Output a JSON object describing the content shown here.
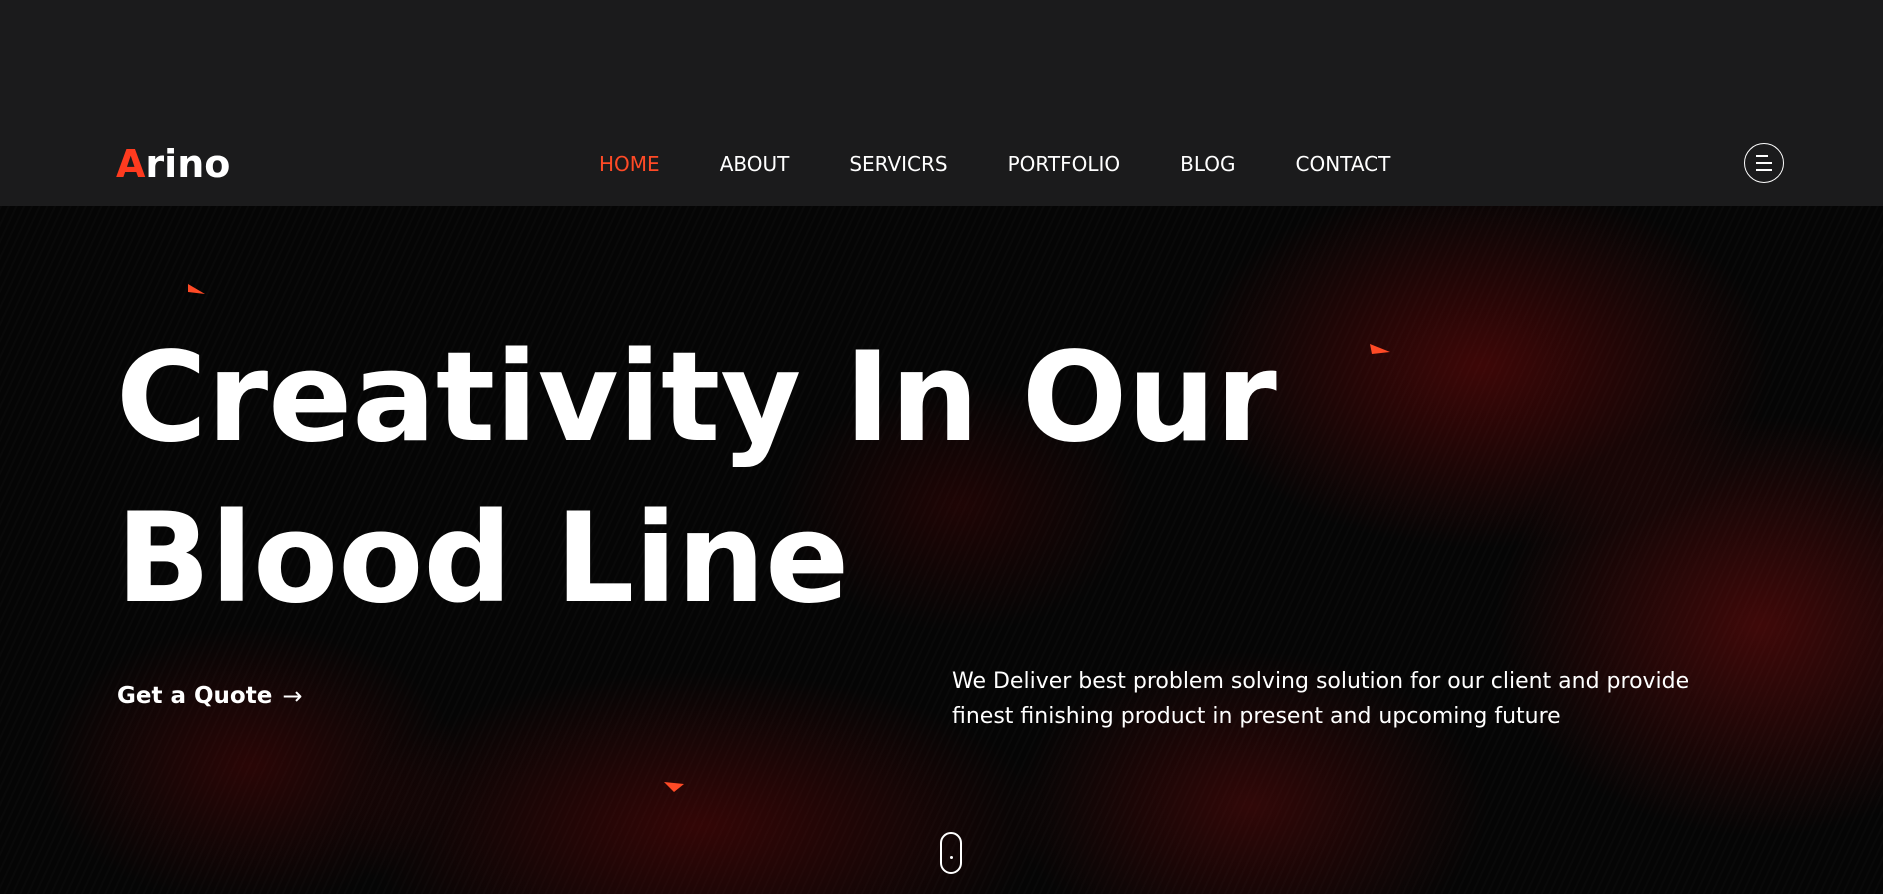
{
  "brand": {
    "logo_first_letter": "A",
    "logo_rest": "rino",
    "accent_color": "#ff3b1f"
  },
  "nav": {
    "items": [
      {
        "label": "HOME",
        "active": true
      },
      {
        "label": "ABOUT",
        "active": false
      },
      {
        "label": "SERVICRS",
        "active": false
      },
      {
        "label": "PORTFOLIO",
        "active": false
      },
      {
        "label": "BLOG",
        "active": false
      },
      {
        "label": "CONTACT",
        "active": false
      }
    ],
    "menu_icon": "hamburger-circle-icon"
  },
  "hero": {
    "headline_line1": "Creativity In Our",
    "headline_line2": "Blood Line",
    "cta_label": "Get a Quote",
    "cta_icon": "arrow-right-icon",
    "description": "We Deliver best problem solving solution for our client and provide finest finishing product in present and upcoming future",
    "scroll_icon": "mouse-scroll-icon"
  },
  "colors": {
    "header_bg": "#1b1b1c",
    "active_nav": "#ff4a26",
    "text": "#ffffff"
  }
}
